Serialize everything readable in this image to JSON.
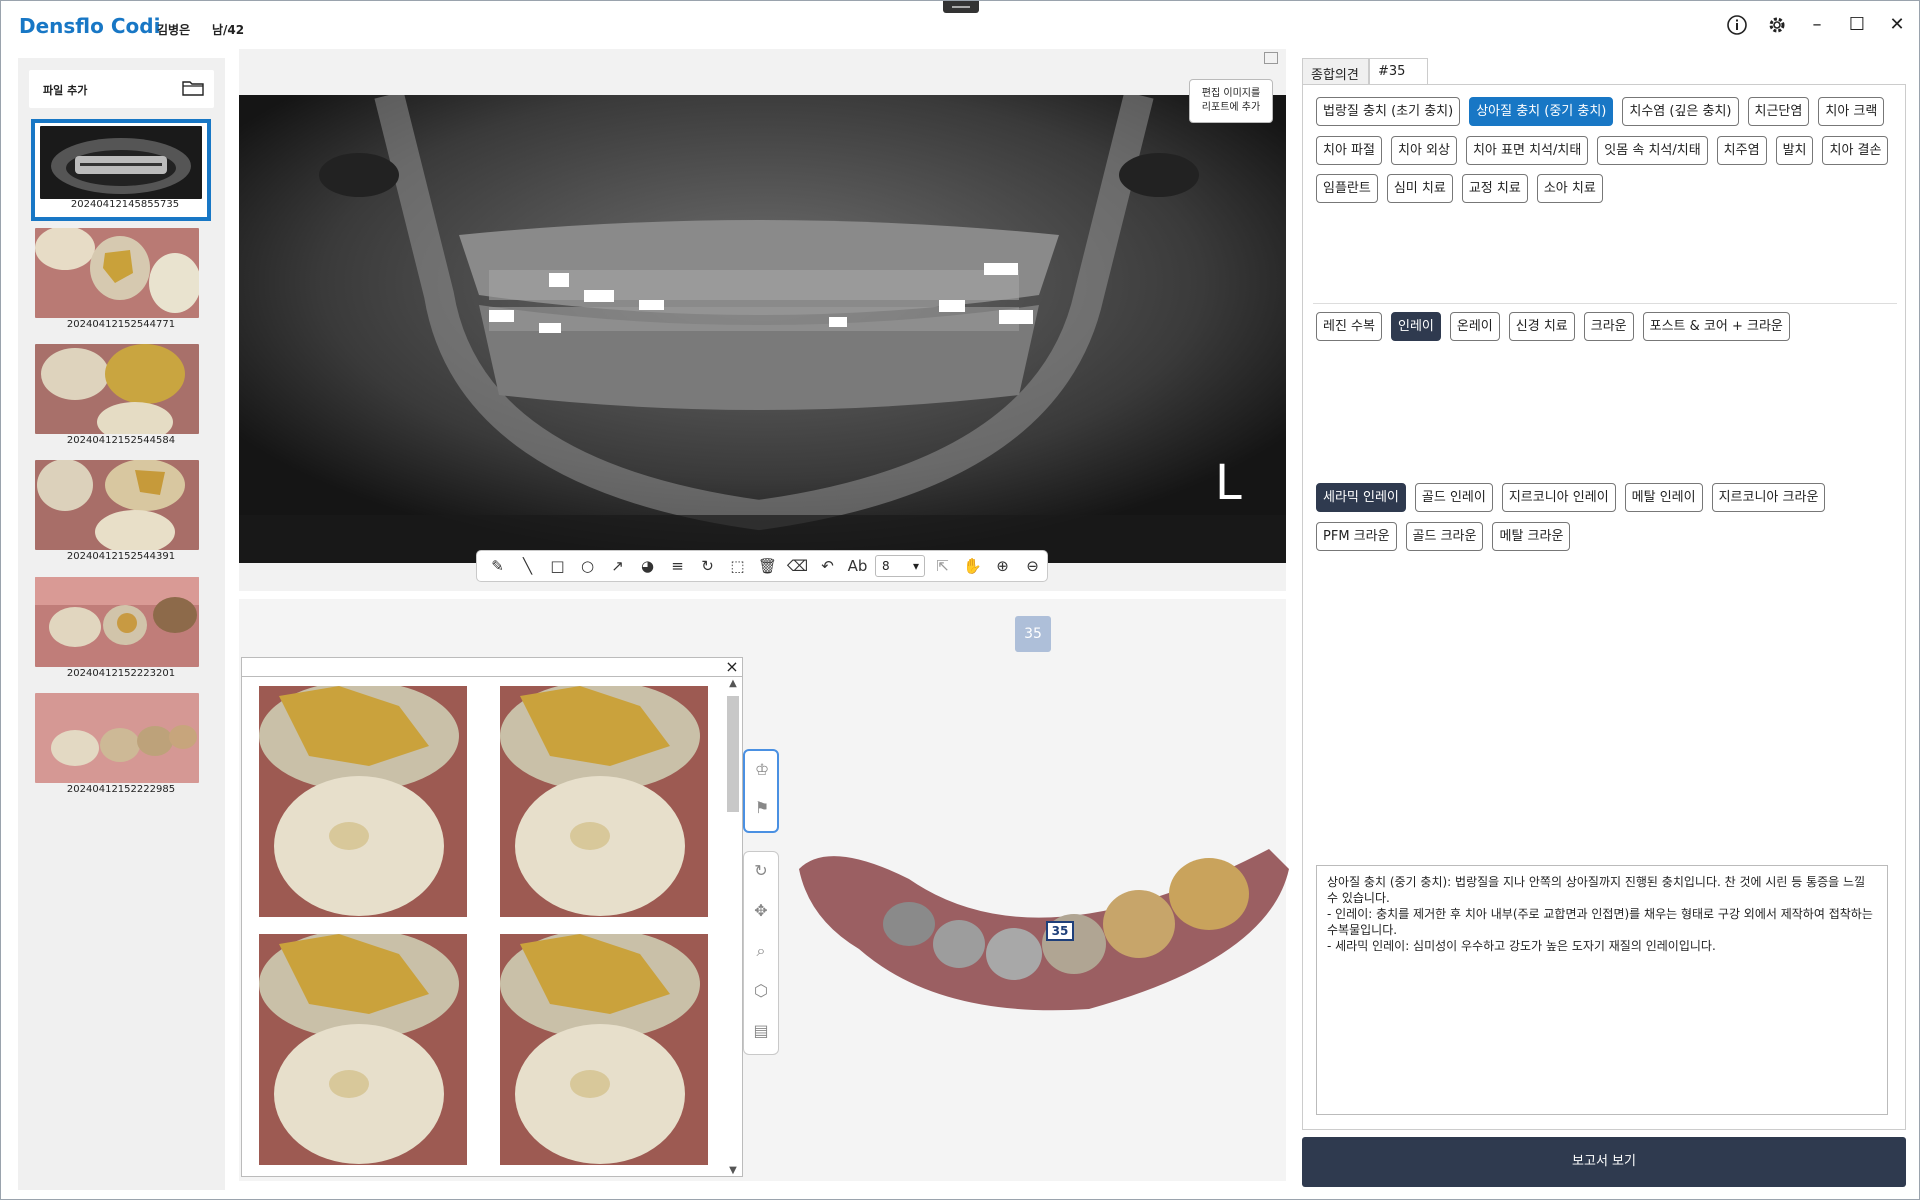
{
  "app": {
    "brand": "Densflo Codi",
    "patient_name": "김병은",
    "patient_info": "남/42"
  },
  "titlebar": {
    "info_icon": "info-icon",
    "settings_icon": "gear-icon",
    "minimize": "–",
    "maximize": "☐",
    "close": "✕"
  },
  "files": {
    "add_label": "파일 추가",
    "items": [
      {
        "label": "20240412145855735",
        "kind": "xray"
      },
      {
        "label": "20240412152544771",
        "kind": "photo"
      },
      {
        "label": "20240412152544584",
        "kind": "photo"
      },
      {
        "label": "20240412152544391",
        "kind": "photo"
      },
      {
        "label": "20240412152223201",
        "kind": "photo"
      },
      {
        "label": "20240412152222985",
        "kind": "photo"
      }
    ]
  },
  "xray": {
    "edit_add_line1": "편집 이미지를",
    "edit_add_line2": "리포트에 추가",
    "side_marker": "L",
    "brush_size": "8"
  },
  "viewer": {
    "tooth_badge": "35",
    "scan_marker": "35"
  },
  "right": {
    "tabs": [
      "종합의견",
      "#35"
    ],
    "diagnosis_rows": [
      [
        "법랑질 충치 (초기 충치)",
        "상아질 충치 (중기 충치)",
        "치수염 (깊은 충치)",
        "치근단염",
        "치아 크랙"
      ],
      [
        "치아 파절",
        "치아 외상",
        "치아 표면 치석/치태",
        "잇몸 속 치석/치태",
        "치주염",
        "발치",
        "치아 결손"
      ],
      [
        "임플란트",
        "심미 치료",
        "교정 치료",
        "소아 치료"
      ]
    ],
    "treatment_row": [
      "레진 수복",
      "인레이",
      "온레이",
      "신경 치료",
      "크라운",
      "포스트 & 코어 + 크라운"
    ],
    "material_rows": [
      [
        "세라믹 인레이",
        "골드 인레이",
        "지르코니아 인레이",
        "메탈 인레이",
        "지르코니아 크라운"
      ],
      [
        "PFM 크라운",
        "골드 크라운",
        "메탈 크라운"
      ]
    ],
    "notes": [
      "상아질 충치 (중기 충치): 법랑질을 지나 안쪽의 상아질까지 진행된 충치입니다. 찬 것에 시린 등 통증을 느낄 수 있습니다.",
      "",
      "- 인레이: 충치를 제거한 후 치아 내부(주로 교합면과 인접면)를 채우는 형태로 구강 외에서 제작하여 접착하는 수복물입니다.",
      "- 세라믹 인레이: 심미성이 우수하고 강도가 높은 도자기 재질의 인레이입니다."
    ],
    "report_button": "보고서 보기"
  },
  "colors": {
    "brand": "#1877c5",
    "dark": "#2f3a4f",
    "badge": "#aebfd9"
  }
}
